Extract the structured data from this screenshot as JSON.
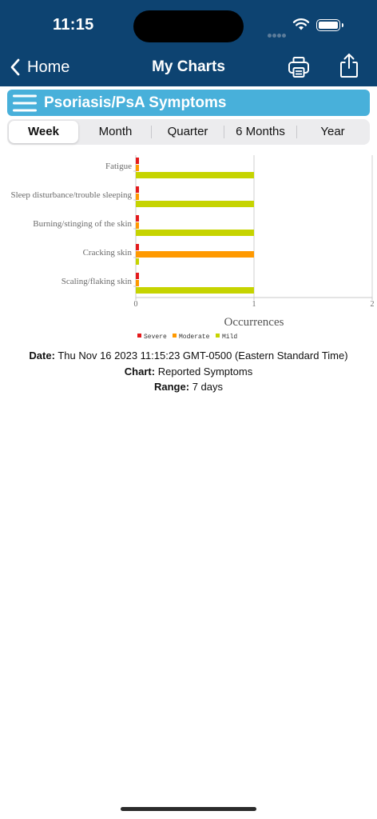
{
  "status": {
    "time": "11:15"
  },
  "nav": {
    "back_label": "Home",
    "title": "My Charts"
  },
  "section": {
    "title": "Psoriasis/PsA Symptoms"
  },
  "tabs": [
    {
      "label": "Week",
      "active": true
    },
    {
      "label": "Month",
      "active": false
    },
    {
      "label": "Quarter",
      "active": false
    },
    {
      "label": "6 Months",
      "active": false
    },
    {
      "label": "Year",
      "active": false
    }
  ],
  "chart_data": {
    "type": "bar",
    "orientation": "horizontal",
    "categories": [
      "Fatigue",
      "Sleep disturbance/trouble sleeping",
      "Burning/stinging of the skin",
      "Cracking skin",
      "Scaling/flaking skin"
    ],
    "series": [
      {
        "name": "Severe",
        "color": "#e41a1c",
        "values": [
          0,
          0,
          0,
          0,
          0
        ]
      },
      {
        "name": "Moderate",
        "color": "#ff9900",
        "values": [
          0,
          0,
          0,
          1,
          0
        ]
      },
      {
        "name": "Mild",
        "color": "#c6d400",
        "values": [
          1,
          1,
          1,
          0,
          1
        ]
      }
    ],
    "xlabel": "Occurrences",
    "xlim": [
      0,
      2
    ],
    "xticks": [
      "0",
      "1",
      "2"
    ],
    "legend_position": "bottom"
  },
  "info": {
    "date_label": "Date:",
    "date_value": "Thu Nov 16 2023 11:15:23 GMT-0500 (Eastern Standard Time)",
    "chart_label": "Chart:",
    "chart_value": "Reported Symptoms",
    "range_label": "Range:",
    "range_value": "7 days"
  }
}
